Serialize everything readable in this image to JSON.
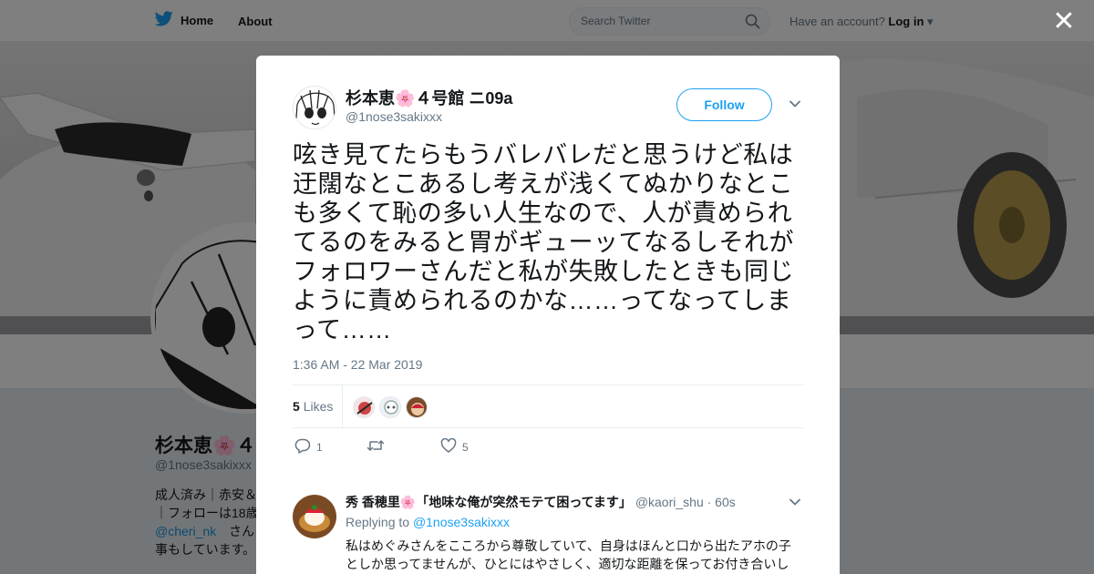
{
  "header": {
    "home_label": "Home",
    "about_label": "About",
    "search_placeholder": "Search Twitter",
    "account_prompt": "Have an account?",
    "login_label": "Log in"
  },
  "profile": {
    "name": "杉本恵🌸４号館 ニ09a",
    "handle": "@1nose3sakixxx",
    "bio_line1": "成人済み｜赤安＆",
    "bio_line2": "｜フォローは18歳",
    "bio_mention": "@cheri_nk",
    "bio_mention_suffix": "さん",
    "bio_line4": "事もしています。"
  },
  "tweet": {
    "author_name": "杉本恵🌸４号館 ニ09a",
    "author_handle": "@1nose3sakixxx",
    "follow_label": "Follow",
    "text": "呟き見てたらもうバレバレだと思うけど私は迂闊なとこあるし考えが浅くてぬかりなとこも多くて恥の多い人生なので、人が責められてるのをみると胃がギューッてなるしそれがフォロワーさんだと私が失敗したときも同じように責められるのかな……ってなってしまって……",
    "timestamp": "1:36 AM - 22 Mar 2019",
    "likes_count": "5",
    "likes_label": "Likes",
    "reply_count": "1",
    "retweet_count": "",
    "like_action_count": "5"
  },
  "reply": {
    "author_name": "秀 香穂里🌸「地味な俺が突然モテて困ってます」",
    "author_handle": "@kaori_shu",
    "time_ago": "· 60s",
    "replying_to_label": "Replying to",
    "replying_to_handle": "@1nose3sakixxx",
    "text": "私はめぐみさんをこころから尊敬していて、自身はほんと口から出たアホの子としか思ってませんが、ひとにはやさしく、適切な距離を保ってお付き合いし"
  },
  "colors": {
    "accent": "#1da1f2",
    "text": "#14171a",
    "secondary": "#657786"
  }
}
